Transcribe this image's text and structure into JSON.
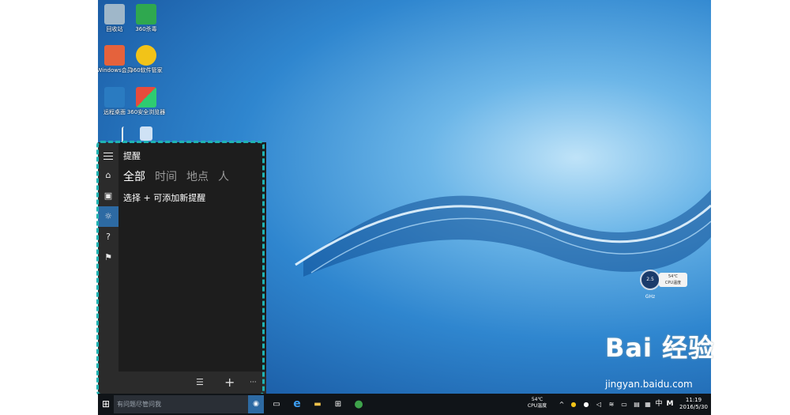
{
  "desktop": {
    "icons": [
      {
        "label": "回收站",
        "icon": "recycle-bin-icon",
        "color": "#9fb7c9"
      },
      {
        "label": "360杀毒",
        "icon": "shield-icon",
        "color": "#2fa84f"
      },
      {
        "label": "Windows会员",
        "icon": "heart-icon",
        "color": "#e5623c"
      },
      {
        "label": "360软件管家",
        "icon": "plus-icon",
        "color": "#f2c318"
      },
      {
        "label": "远程桌面",
        "icon": "remote-desktop-icon",
        "color": "#2a7bc1"
      },
      {
        "label": "360安全浏览器",
        "icon": "tiles-icon",
        "color": "#3ea34b"
      }
    ]
  },
  "cortana": {
    "title": "提醒",
    "tabs": [
      {
        "label": "全部",
        "active": true
      },
      {
        "label": "时间",
        "active": false
      },
      {
        "label": "地点",
        "active": false
      },
      {
        "label": "人",
        "active": false
      }
    ],
    "hint": "选择 + 可添加新提醒",
    "rail": [
      {
        "icon": "hamburger-menu-icon"
      },
      {
        "icon": "home-icon",
        "glyph": "⌂"
      },
      {
        "icon": "notebook-icon",
        "glyph": "▣"
      },
      {
        "icon": "lightbulb-icon",
        "glyph": "☼",
        "active": true
      },
      {
        "icon": "help-icon",
        "glyph": "?"
      },
      {
        "icon": "feedback-icon",
        "glyph": "⚑"
      }
    ],
    "commands": [
      {
        "icon": "list-icon",
        "glyph": "☰"
      },
      {
        "icon": "add-icon",
        "glyph": "+"
      },
      {
        "icon": "more-icon",
        "glyph": "···"
      }
    ],
    "accent": "#2d6aa3",
    "highlight_border": "#1fb3b3"
  },
  "taskbar": {
    "start_glyph": "⊞",
    "search_placeholder": "有问题尽管问我",
    "mic_glyph": "◉",
    "apps": [
      {
        "icon": "task-view-icon",
        "glyph": "▭"
      },
      {
        "icon": "edge-icon",
        "glyph": "e"
      },
      {
        "icon": "file-explorer-icon",
        "glyph": "▬"
      },
      {
        "icon": "store-icon",
        "glyph": "⊞"
      },
      {
        "icon": "360-browser-icon",
        "glyph": "●"
      }
    ],
    "temp": "54℃",
    "temp_label": "CPU温度",
    "ime": "中",
    "ime2": "M",
    "time": "11:19",
    "date": "2016/5/30"
  },
  "cpu_widget": {
    "speed": "2.5 GHz",
    "temp": "54℃",
    "label": "CPU温度"
  },
  "watermark": {
    "text": "Bai 经验",
    "url": "jingyan.baidu.com"
  }
}
